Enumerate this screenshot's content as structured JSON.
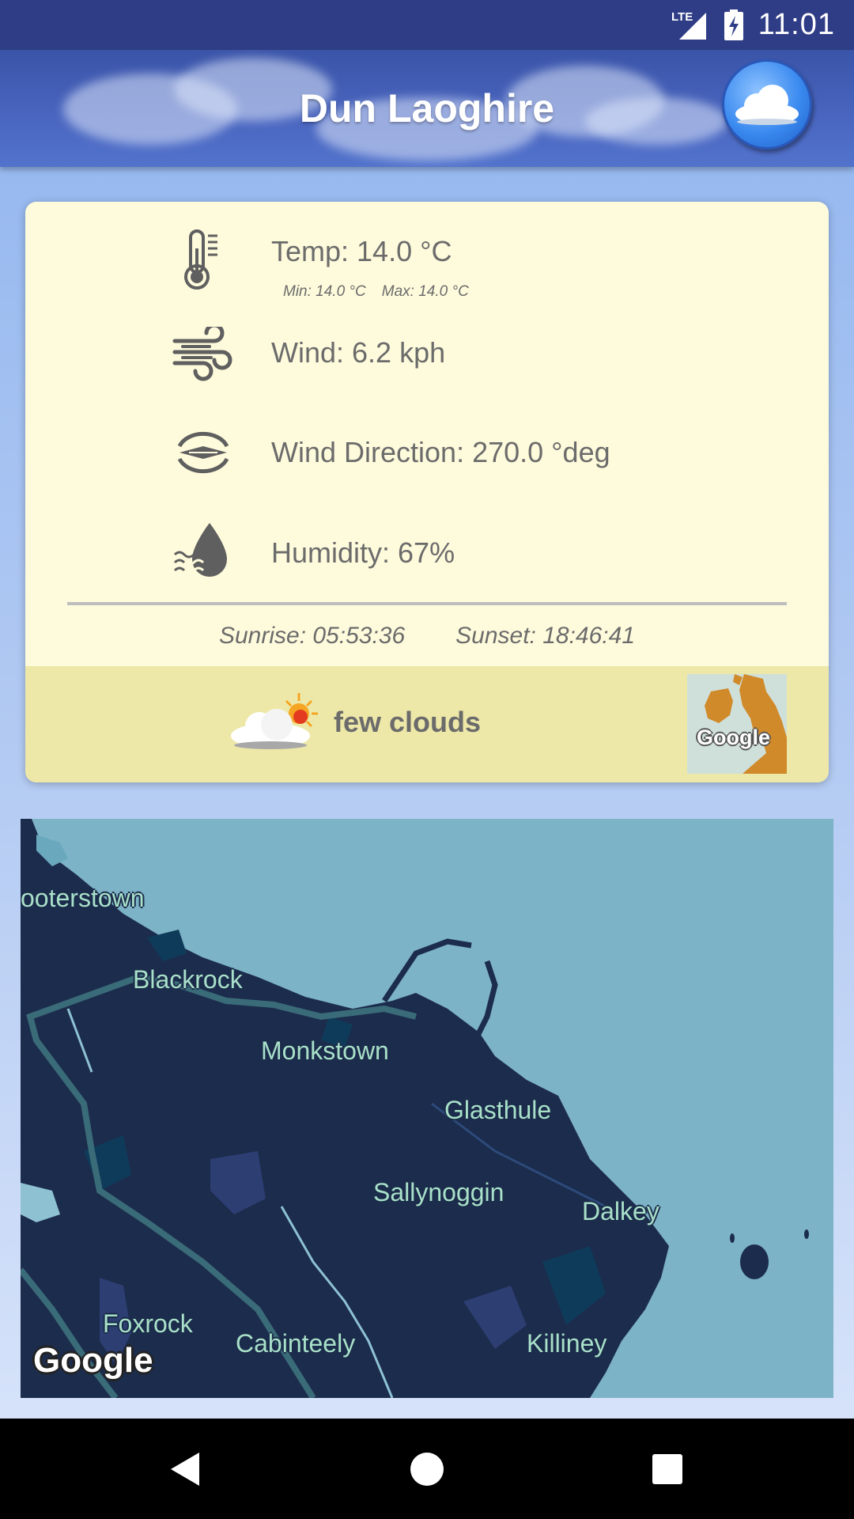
{
  "status_bar": {
    "time": "11:01",
    "network_label": "LTE",
    "icons": [
      "signal-icon",
      "battery-charging-icon"
    ]
  },
  "header": {
    "title": "Dun Laoghire",
    "weather_button_icon": "cloud-icon"
  },
  "weather": {
    "temp": "Temp: 14.0 °C",
    "min": "Min: 14.0 °C",
    "max": "Max: 14.0 °C",
    "wind": "Wind: 6.2 kph",
    "wind_direction": "Wind Direction: 270.0 °deg",
    "humidity": "Humidity: 67%",
    "sunrise": "Sunrise: 05:53:36",
    "sunset": "Sunset: 18:46:41",
    "condition": "few clouds",
    "icons": {
      "temp": "thermometer-icon",
      "wind": "wind-icon",
      "wind_direction": "compass-icon",
      "humidity": "humidity-drop-icon",
      "condition": "few-clouds-icon"
    },
    "mini_map_label": "Google"
  },
  "map": {
    "labels": [
      "ooterstown",
      "Blackrock",
      "Monkstown",
      "Glasthule",
      "Sallynoggin",
      "Dalkey",
      "Foxrock",
      "Cabinteely",
      "Killiney"
    ],
    "attribution": "Google",
    "colors": {
      "sea": "#7db3c7",
      "land": "#1c2c4c",
      "road": "#3a6b78"
    }
  },
  "nav": {
    "back_icon": "back-triangle-icon",
    "home_icon": "home-circle-icon",
    "recents_icon": "recents-square-icon"
  }
}
